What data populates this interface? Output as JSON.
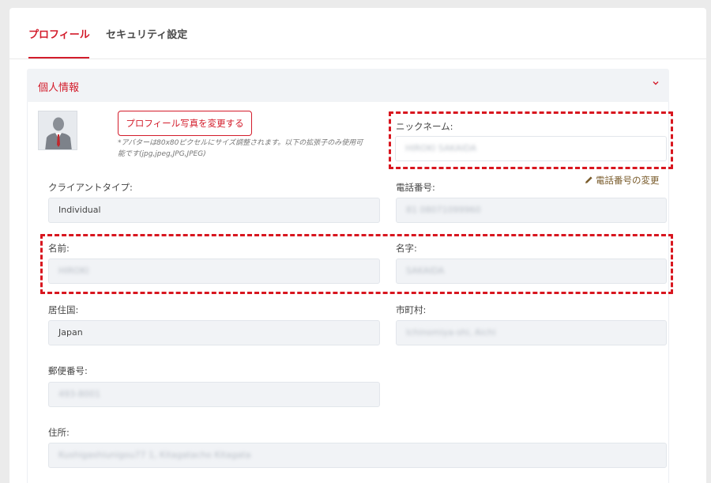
{
  "tabs": {
    "profile": "プロフィール",
    "security": "セキュリティ設定"
  },
  "section": {
    "title": "個人情報"
  },
  "photo": {
    "button_label": "プロフィール写真を変更する",
    "note_line1": "*アバターは80x80ピクセルにサイズ調整されます。以下の拡張子のみ使用可",
    "note_line2": "能です(jpg,jpeg,JPG,JPEG)"
  },
  "fields": {
    "nickname": {
      "label": "ニックネーム:",
      "value": "HIROKI SAKAIDA"
    },
    "client_type": {
      "label": "クライアントタイプ:",
      "value": "Individual"
    },
    "phone": {
      "label": "電話番号:",
      "value": "81 08071099960",
      "change_label": "電話番号の変更"
    },
    "first_name": {
      "label": "名前:",
      "value": "HIROKI"
    },
    "last_name": {
      "label": "名字:",
      "value": "SAKAIDA"
    },
    "country": {
      "label": "居住国:",
      "value": "Japan"
    },
    "city": {
      "label": "市町村:",
      "value": "Ichinomiya-shi, Aichi"
    },
    "postal_code": {
      "label": "郵便番号:",
      "value": "493-8001"
    },
    "address": {
      "label": "住所:",
      "value": "Kushigashiunigou77 1, Kitagatacho Kitagata"
    }
  },
  "colors": {
    "accent": "#d31c2b",
    "highlight_dash": "#d8161f",
    "field_bg": "#f1f3f6"
  },
  "icons": {
    "chevron": "chevron-down-icon",
    "pencil": "pencil-icon",
    "avatar": "avatar-placeholder"
  }
}
